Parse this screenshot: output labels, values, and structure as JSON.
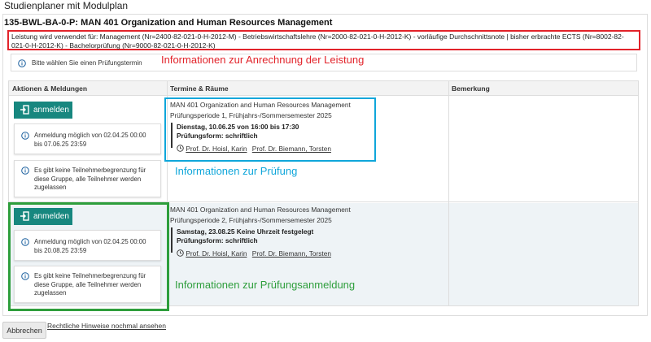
{
  "page": {
    "title": "Studienplaner mit Modulplan"
  },
  "module": {
    "title": "135-BWL-BA-0-P: MAN 401 Organization and Human Resources Management",
    "usage_info": "Leistung wird verwendet für: Management (Nr=2400-82-021-0-H-2012-M) - Betriebswirtschaftslehre (Nr=2000-82-021-0-H-2012-K) - vorläufige Durchschnittsnote | bisher erbrachte ECTS (Nr=8002-82-021-0-H-2012-K) - Bachelorprüfung (Nr=9000-82-021-0-H-2012-K)",
    "select_message": "Bitte wählen Sie einen Prüfungstermin"
  },
  "annotations": {
    "anrechnung": "Informationen zur Anrechnung der Leistung",
    "pruefung": "Informationen zur Prüfung",
    "anmeldung": "Informationen zur Prüfungsanmeldung",
    "colors": {
      "red": "#e2232a",
      "blue": "#0fa6da",
      "green": "#2e9e3c"
    }
  },
  "table": {
    "headers": [
      "Aktionen & Meldungen",
      "Termine & Räume",
      "Bemerkung"
    ],
    "rows": [
      {
        "register_label": "anmelden",
        "registration_info": "Anmeldung möglich von 02.04.25 00:00 bis 07.06.25 23:59",
        "participant_info": "Es gibt keine Teilnehmerbegrenzung für diese Gruppe, alle Teilnehmer werden zugelassen",
        "exam_title": "MAN 401 Organization and Human Resources Management",
        "exam_period": "Prüfungsperiode 1, Frühjahrs-/Sommersemester 2025",
        "exam_date": "Dienstag, 10.06.25 von 16:00 bis 17:30",
        "exam_form": "Prüfungsform: schriftlich",
        "examiners": [
          "Prof. Dr. Hoisl, Karin",
          "Prof. Dr. Biemann, Torsten"
        ],
        "remark": ""
      },
      {
        "register_label": "anmelden",
        "registration_info": "Anmeldung möglich von 02.04.25 00:00 bis 20.08.25 23:59",
        "participant_info": "Es gibt keine Teilnehmerbegrenzung für diese Gruppe, alle Teilnehmer werden zugelassen",
        "exam_title": "MAN 401 Organization and Human Resources Management",
        "exam_period": "Prüfungsperiode 2, Frühjahrs-/Sommersemester 2025",
        "exam_date": "Samstag, 23.08.25 Keine Uhrzeit festgelegt",
        "exam_form": "Prüfungsform: schriftlich",
        "examiners": [
          "Prof. Dr. Hoisl, Karin",
          "Prof. Dr. Biemann, Torsten"
        ],
        "remark": ""
      }
    ]
  },
  "footer": {
    "cancel_label": "Abbrechen",
    "legal_link": "Rechtliche Hinweise nochmal ansehen"
  },
  "icons": [
    "info-icon",
    "enter-icon",
    "clock-icon"
  ],
  "colors": {
    "primary_button": "#17877f",
    "row_alt": "#eef3f6"
  }
}
